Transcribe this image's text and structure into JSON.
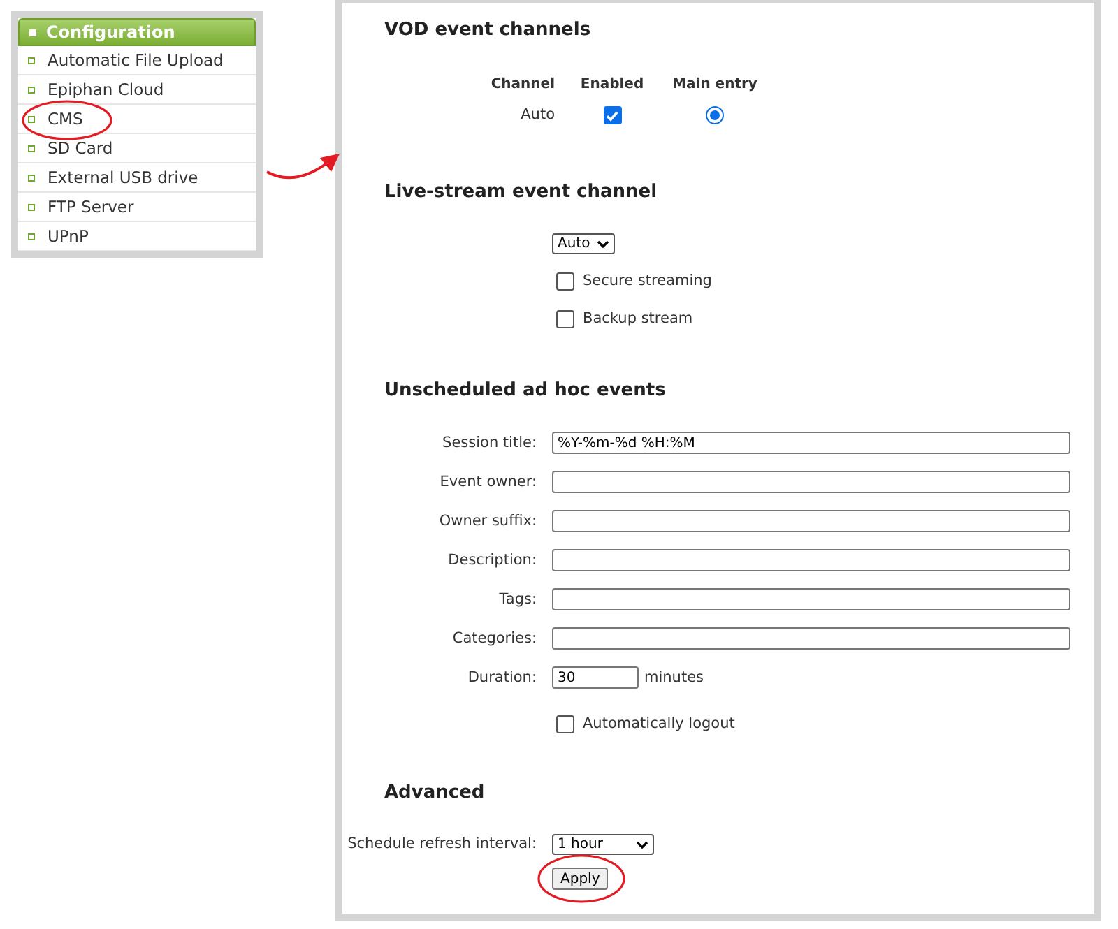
{
  "menu": {
    "title": "Configuration",
    "items": [
      {
        "label": "Automatic File Upload",
        "circled": false
      },
      {
        "label": "Epiphan Cloud",
        "circled": false
      },
      {
        "label": "CMS",
        "circled": true
      },
      {
        "label": "SD Card",
        "circled": false
      },
      {
        "label": "External USB drive",
        "circled": false
      },
      {
        "label": "FTP Server",
        "circled": false
      },
      {
        "label": "UPnP",
        "circled": false
      }
    ]
  },
  "vod": {
    "title": "VOD event channels",
    "columns": [
      "Channel",
      "Enabled",
      "Main entry"
    ],
    "rows": [
      {
        "channel": "Auto",
        "enabled": true,
        "main_entry": true
      }
    ]
  },
  "live": {
    "title": "Live-stream event channel",
    "select": {
      "value": "Auto"
    },
    "options": [
      {
        "label": "Secure streaming",
        "checked": false
      },
      {
        "label": "Backup stream",
        "checked": false
      }
    ]
  },
  "adhoc": {
    "title": "Unscheduled ad hoc events",
    "fields": [
      {
        "label": "Session title:",
        "value": "%Y-%m-%d %H:%M"
      },
      {
        "label": "Event owner:"
      },
      {
        "label": "Owner suffix:"
      },
      {
        "label": "Description:"
      },
      {
        "label": "Tags:"
      },
      {
        "label": "Categories:"
      }
    ],
    "duration": {
      "label": "Duration:",
      "value": "30",
      "unit": "minutes"
    },
    "autologout": {
      "label": "Automatically logout",
      "checked": false
    }
  },
  "advanced": {
    "title": "Advanced",
    "refresh": {
      "label": "Schedule refresh interval:",
      "value": "1 hour"
    },
    "apply": {
      "label": "Apply",
      "circled": true
    }
  }
}
